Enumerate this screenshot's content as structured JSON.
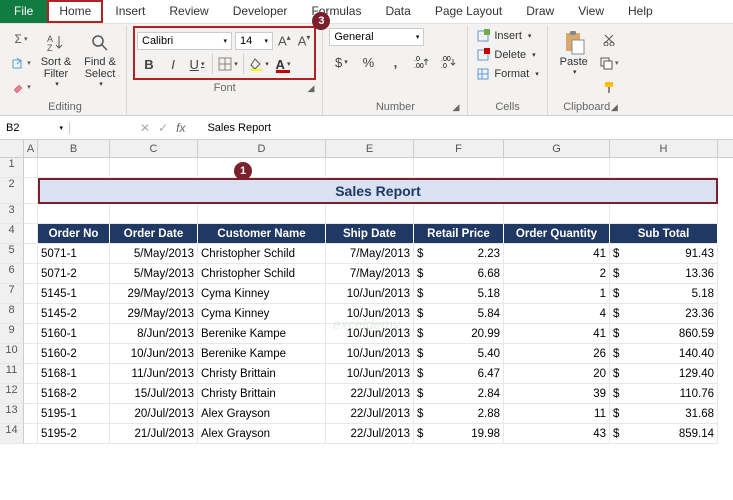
{
  "menu": {
    "file": "File",
    "items": [
      "Home",
      "Insert",
      "Review",
      "Developer",
      "Formulas",
      "Data",
      "Page Layout",
      "Draw",
      "View",
      "Help"
    ],
    "active": "Home"
  },
  "ribbon": {
    "editing": {
      "label": "Editing",
      "sort_filter": "Sort &\nFilter",
      "find_select": "Find &\nSelect"
    },
    "font": {
      "label": "Font",
      "name": "Calibri",
      "size": "14",
      "bold": "B",
      "italic": "I",
      "underline": "U"
    },
    "number": {
      "label": "Number",
      "format": "General"
    },
    "cells": {
      "label": "Cells",
      "insert": "Insert",
      "delete": "Delete",
      "format": "Format"
    },
    "clipboard": {
      "label": "Clipboard",
      "paste": "Paste"
    }
  },
  "namebox": "B2",
  "formula": "Sales Report",
  "annotations": {
    "a1": "1",
    "a2": "2",
    "a3": "3"
  },
  "cols": [
    "A",
    "B",
    "C",
    "D",
    "E",
    "F",
    "G",
    "H"
  ],
  "title": "Sales Report",
  "headers": [
    "Order No",
    "Order Date",
    "Customer Name",
    "Ship Date",
    "Retail Price",
    "Order Quantity",
    "Sub Total"
  ],
  "chart_data": {
    "type": "table",
    "columns": [
      "Order No",
      "Order Date",
      "Customer Name",
      "Ship Date",
      "Retail Price",
      "Order Quantity",
      "Sub Total"
    ],
    "rows": [
      [
        "5071-1",
        "5/May/2013",
        "Christopher Schild",
        "7/May/2013",
        2.23,
        41,
        91.43
      ],
      [
        "5071-2",
        "5/May/2013",
        "Christopher Schild",
        "7/May/2013",
        6.68,
        2,
        13.36
      ],
      [
        "5145-1",
        "29/May/2013",
        "Cyma Kinney",
        "10/Jun/2013",
        5.18,
        1,
        5.18
      ],
      [
        "5145-2",
        "29/May/2013",
        "Cyma Kinney",
        "10/Jun/2013",
        5.84,
        4,
        23.36
      ],
      [
        "5160-1",
        "8/Jun/2013",
        "Berenike Kampe",
        "10/Jun/2013",
        20.99,
        41,
        860.59
      ],
      [
        "5160-2",
        "10/Jun/2013",
        "Berenike Kampe",
        "10/Jun/2013",
        5.4,
        26,
        140.4
      ],
      [
        "5168-1",
        "11/Jun/2013",
        "Christy Brittain",
        "10/Jun/2013",
        6.47,
        20,
        129.4
      ],
      [
        "5168-2",
        "15/Jul/2013",
        "Christy Brittain",
        "22/Jul/2013",
        2.84,
        39,
        110.76
      ],
      [
        "5195-1",
        "20/Jul/2013",
        "Alex Grayson",
        "22/Jul/2013",
        2.88,
        11,
        31.68
      ],
      [
        "5195-2",
        "21/Jul/2013",
        "Alex Grayson",
        "22/Jul/2013",
        19.98,
        43,
        859.14
      ]
    ]
  },
  "rows": [
    {
      "no": "5071-1",
      "od": "5/May/2013",
      "cn": "Christopher Schild",
      "sd": "7/May/2013",
      "rp": "2.23",
      "oq": "41",
      "st": "91.43"
    },
    {
      "no": "5071-2",
      "od": "5/May/2013",
      "cn": "Christopher Schild",
      "sd": "7/May/2013",
      "rp": "6.68",
      "oq": "2",
      "st": "13.36"
    },
    {
      "no": "5145-1",
      "od": "29/May/2013",
      "cn": "Cyma Kinney",
      "sd": "10/Jun/2013",
      "rp": "5.18",
      "oq": "1",
      "st": "5.18"
    },
    {
      "no": "5145-2",
      "od": "29/May/2013",
      "cn": "Cyma Kinney",
      "sd": "10/Jun/2013",
      "rp": "5.84",
      "oq": "4",
      "st": "23.36"
    },
    {
      "no": "5160-1",
      "od": "8/Jun/2013",
      "cn": "Berenike Kampe",
      "sd": "10/Jun/2013",
      "rp": "20.99",
      "oq": "41",
      "st": "860.59"
    },
    {
      "no": "5160-2",
      "od": "10/Jun/2013",
      "cn": "Berenike Kampe",
      "sd": "10/Jun/2013",
      "rp": "5.40",
      "oq": "26",
      "st": "140.40"
    },
    {
      "no": "5168-1",
      "od": "11/Jun/2013",
      "cn": "Christy Brittain",
      "sd": "10/Jun/2013",
      "rp": "6.47",
      "oq": "20",
      "st": "129.40"
    },
    {
      "no": "5168-2",
      "od": "15/Jul/2013",
      "cn": "Christy Brittain",
      "sd": "22/Jul/2013",
      "rp": "2.84",
      "oq": "39",
      "st": "110.76"
    },
    {
      "no": "5195-1",
      "od": "20/Jul/2013",
      "cn": "Alex Grayson",
      "sd": "22/Jul/2013",
      "rp": "2.88",
      "oq": "11",
      "st": "31.68"
    },
    {
      "no": "5195-2",
      "od": "21/Jul/2013",
      "cn": "Alex Grayson",
      "sd": "22/Jul/2013",
      "rp": "19.98",
      "oq": "43",
      "st": "859.14"
    }
  ],
  "sym": {
    "dollar": "$"
  }
}
